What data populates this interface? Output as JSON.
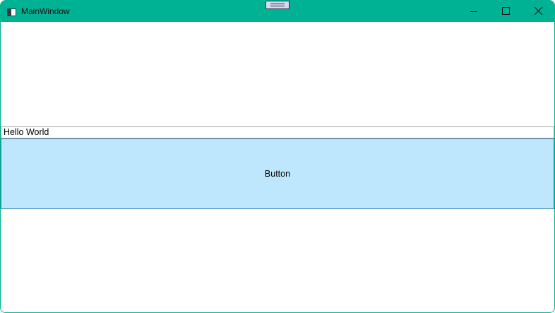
{
  "window": {
    "title": "MainWindow",
    "accent_color": "#00b294",
    "icons": {
      "app": "app-window-icon",
      "minimize": "minimize-icon",
      "maximize": "maximize-icon",
      "close": "close-icon",
      "drag": "drag-handle-icon"
    }
  },
  "main": {
    "textbox_value": "Hello World",
    "button_label": "Button",
    "button_color": "#bee6fd"
  }
}
